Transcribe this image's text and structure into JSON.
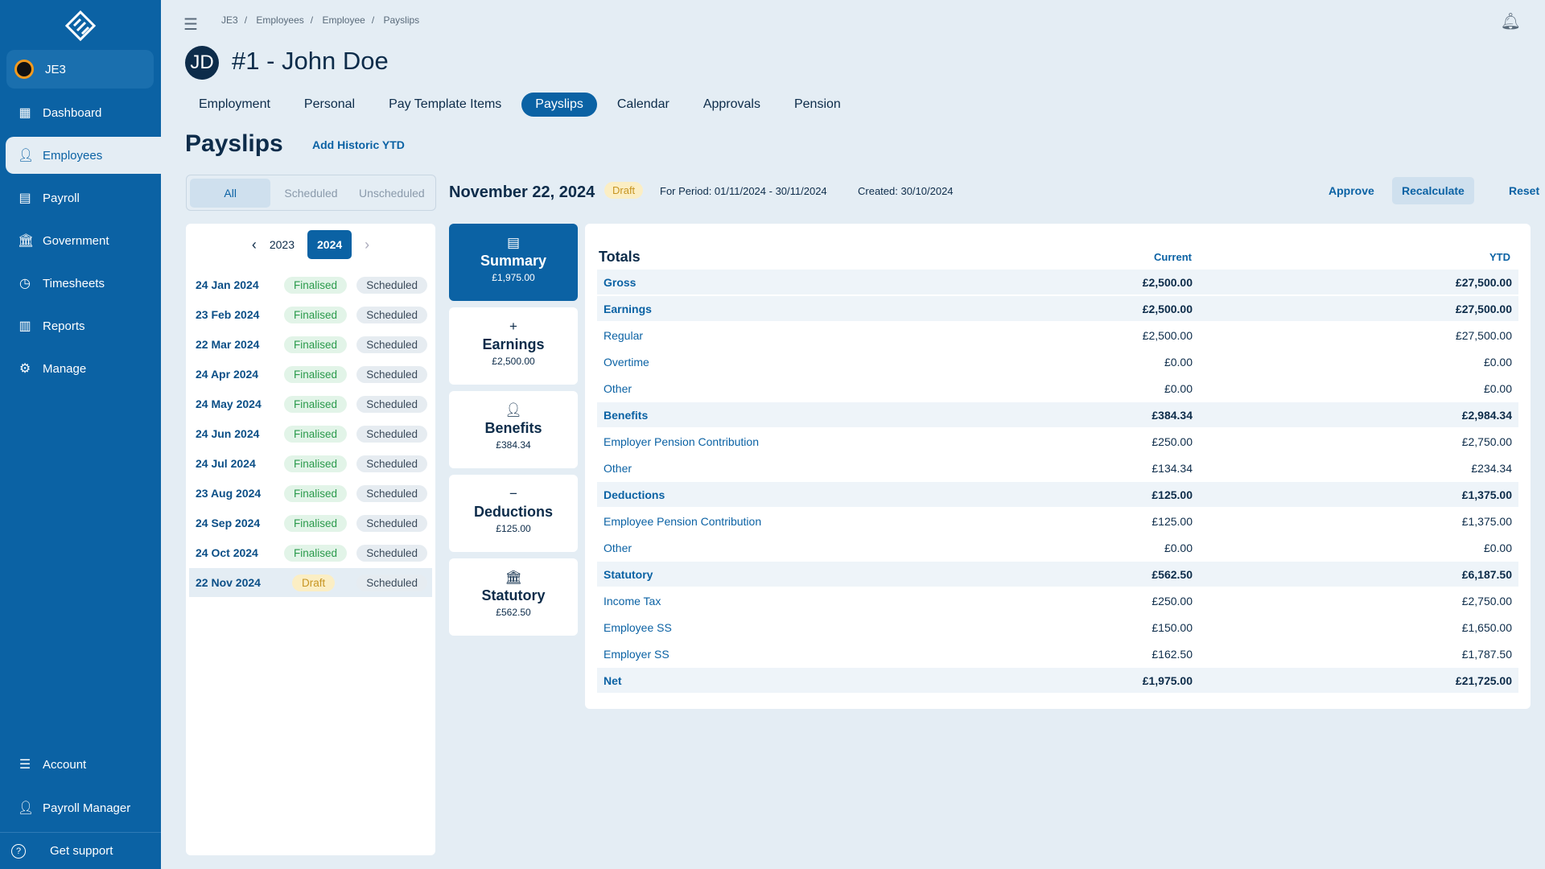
{
  "sidebar": {
    "org": "JE3",
    "items": [
      {
        "label": "Dashboard",
        "icon": "dashboard-icon"
      },
      {
        "label": "Employees",
        "icon": "person-icon"
      },
      {
        "label": "Payroll",
        "icon": "clipboard-icon"
      },
      {
        "label": "Government",
        "icon": "bank-icon"
      },
      {
        "label": "Timesheets",
        "icon": "clock-icon"
      },
      {
        "label": "Reports",
        "icon": "chart-icon"
      },
      {
        "label": "Manage",
        "icon": "gear-icon"
      }
    ],
    "account": "Account",
    "user": "Payroll Manager",
    "support": "Get support"
  },
  "breadcrumb": [
    "JE3",
    "Employees",
    "Employee",
    "Payslips"
  ],
  "employee": {
    "initials": "JD",
    "title": "#1 -  John Doe"
  },
  "tabs": [
    "Employment",
    "Personal",
    "Pay Template Items",
    "Payslips",
    "Calendar",
    "Approvals",
    "Pension"
  ],
  "page": {
    "heading": "Payslips",
    "add_historic": "Add Historic YTD"
  },
  "filter": [
    "All",
    "Scheduled",
    "Unscheduled"
  ],
  "payslip": {
    "date": "November 22, 2024",
    "status": "Draft",
    "period": "For Period: 01/11/2024 - 30/11/2024",
    "created": "Created: 30/10/2024",
    "approve": "Approve",
    "recalculate": "Recalculate",
    "reset": "Reset"
  },
  "years": [
    "2023",
    "2024"
  ],
  "list": [
    {
      "date": "24 Jan 2024",
      "status": "Finalised",
      "type": "Scheduled"
    },
    {
      "date": "23 Feb 2024",
      "status": "Finalised",
      "type": "Scheduled"
    },
    {
      "date": "22 Mar 2024",
      "status": "Finalised",
      "type": "Scheduled"
    },
    {
      "date": "24 Apr 2024",
      "status": "Finalised",
      "type": "Scheduled"
    },
    {
      "date": "24 May 2024",
      "status": "Finalised",
      "type": "Scheduled"
    },
    {
      "date": "24 Jun 2024",
      "status": "Finalised",
      "type": "Scheduled"
    },
    {
      "date": "24 Jul 2024",
      "status": "Finalised",
      "type": "Scheduled"
    },
    {
      "date": "23 Aug 2024",
      "status": "Finalised",
      "type": "Scheduled"
    },
    {
      "date": "24 Sep 2024",
      "status": "Finalised",
      "type": "Scheduled"
    },
    {
      "date": "24 Oct 2024",
      "status": "Finalised",
      "type": "Scheduled"
    },
    {
      "date": "22 Nov 2024",
      "status": "Draft",
      "type": "Scheduled"
    }
  ],
  "cards": [
    {
      "label": "Summary",
      "value": "£1,975.00",
      "icon": "clipboard-icon"
    },
    {
      "label": "Earnings",
      "value": "£2,500.00",
      "icon": "plus-icon"
    },
    {
      "label": "Benefits",
      "value": "£384.34",
      "icon": "person-add-icon"
    },
    {
      "label": "Deductions",
      "value": "£125.00",
      "icon": "minus-icon"
    },
    {
      "label": "Statutory",
      "value": "£562.50",
      "icon": "bank-icon"
    }
  ],
  "totals": {
    "title": "Totals",
    "current": "Current",
    "ytd": "YTD",
    "rows": [
      {
        "label": "Gross",
        "current": "£2,500.00",
        "ytd": "£27,500.00",
        "bold": true
      },
      {
        "label": "Earnings",
        "current": "£2,500.00",
        "ytd": "£27,500.00",
        "bold": true
      },
      {
        "label": "Regular",
        "current": "£2,500.00",
        "ytd": "£27,500.00"
      },
      {
        "label": "Overtime",
        "current": "£0.00",
        "ytd": "£0.00"
      },
      {
        "label": "Other",
        "current": "£0.00",
        "ytd": "£0.00"
      },
      {
        "label": "Benefits",
        "current": "£384.34",
        "ytd": "£2,984.34",
        "bold": true
      },
      {
        "label": "Employer Pension Contribution",
        "current": "£250.00",
        "ytd": "£2,750.00"
      },
      {
        "label": "Other",
        "current": "£134.34",
        "ytd": "£234.34"
      },
      {
        "label": "Deductions",
        "current": "£125.00",
        "ytd": "£1,375.00",
        "bold": true
      },
      {
        "label": "Employee Pension Contribution",
        "current": "£125.00",
        "ytd": "£1,375.00"
      },
      {
        "label": "Other",
        "current": "£0.00",
        "ytd": "£0.00"
      },
      {
        "label": "Statutory",
        "current": "£562.50",
        "ytd": "£6,187.50",
        "bold": true
      },
      {
        "label": "Income Tax",
        "current": "£250.00",
        "ytd": "£2,750.00"
      },
      {
        "label": "Employee SS",
        "current": "£150.00",
        "ytd": "£1,650.00"
      },
      {
        "label": "Employer SS",
        "current": "£162.50",
        "ytd": "£1,787.50"
      },
      {
        "label": "Net",
        "current": "£1,975.00",
        "ytd": "£21,725.00",
        "bold": true
      }
    ]
  }
}
